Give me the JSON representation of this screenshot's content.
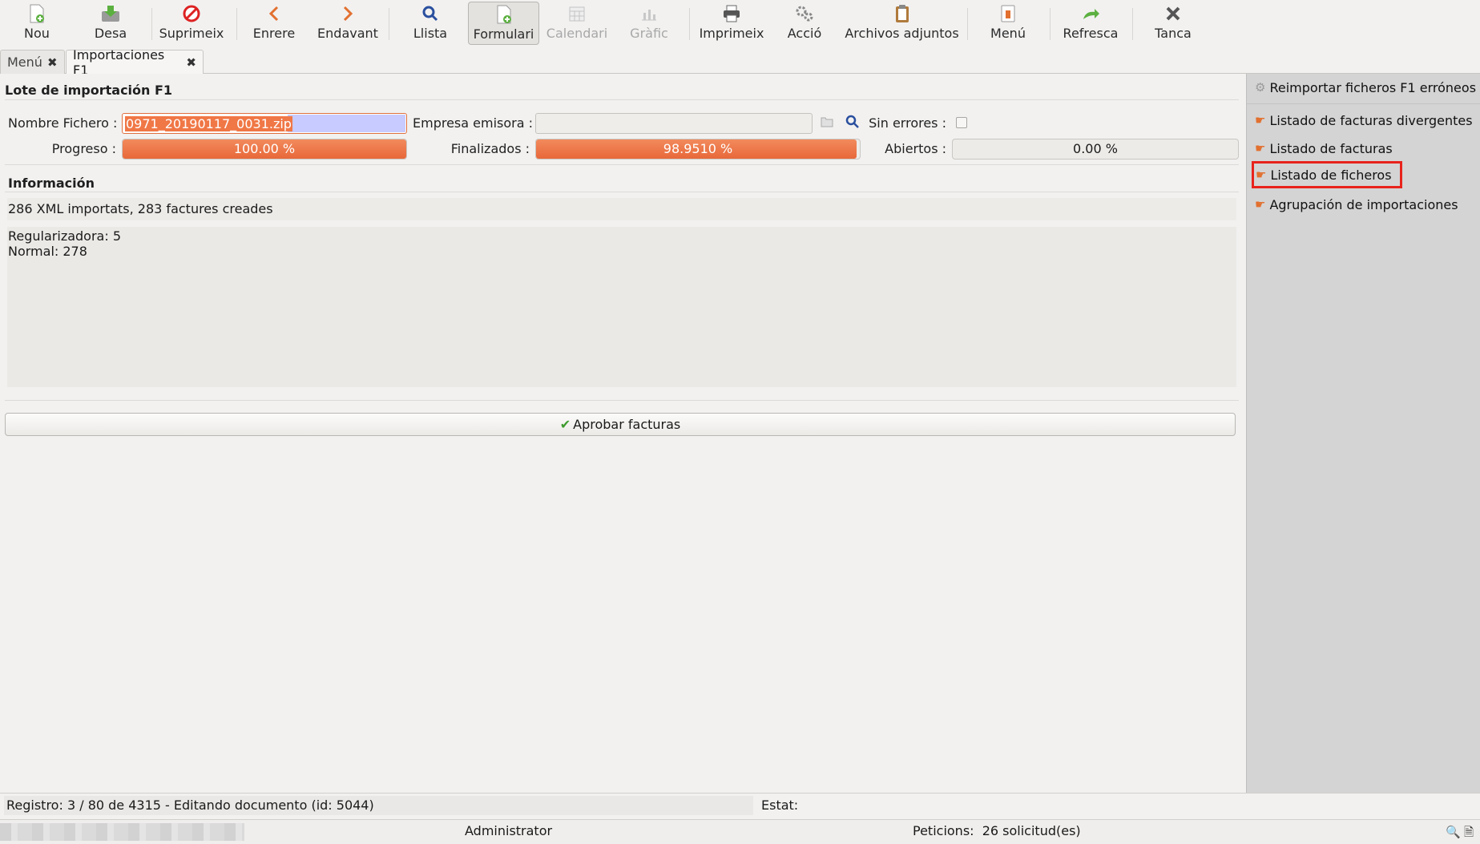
{
  "toolbar": {
    "new": "Nou",
    "save": "Desa",
    "delete": "Suprimeix",
    "back": "Enrere",
    "forward": "Endavant",
    "list": "Llista",
    "form": "Formulari",
    "calendar": "Calendari",
    "graph": "Gràfic",
    "print": "Imprimeix",
    "action": "Acció",
    "attachments": "Archivos adjuntos",
    "menu": "Menú",
    "refresh": "Refresca",
    "close": "Tanca"
  },
  "tabs": [
    {
      "label": "Menú",
      "close": "✖"
    },
    {
      "label": "Importaciones F1",
      "close": "✖"
    }
  ],
  "form": {
    "section_title": "Lote de importación F1",
    "filename_label": "Nombre Fichero :",
    "filename_value": "0971_20190117_0031.zip",
    "company_label": "Empresa emisora :",
    "company_value": "",
    "no_errors_label": "Sin errores :",
    "no_errors_checked": false,
    "progress_label": "Progreso :",
    "progress_text": "100.00 %",
    "progress_value": 100.0,
    "finished_label": "Finalizados :",
    "finished_text": "98.9510 %",
    "finished_value": 98.951,
    "open_label": "Abiertos :",
    "open_text": "0.00 %",
    "open_value": 0.0,
    "info_title": "Información",
    "info_summary": "286 XML importats, 283 factures creades",
    "info_details": "Regularizadora: 5\nNormal: 278",
    "approve_button": "Aprobar facturas"
  },
  "sidebar": {
    "items": [
      {
        "label": "Reimportar ficheros F1 erróneos",
        "icon": "gears-icon"
      },
      {
        "label": "Listado de facturas divergentes",
        "icon": "hand-icon"
      },
      {
        "label": "Listado de facturas",
        "icon": "hand-icon"
      },
      {
        "label": "Listado de ficheros",
        "icon": "hand-icon",
        "highlighted": true
      },
      {
        "label": "Agrupación de importaciones",
        "icon": "hand-icon"
      }
    ]
  },
  "status": {
    "record": "Registro: 3 / 80 de 4315 - Editando documento (id: 5044)",
    "state_label": "Estat:",
    "user": "Administrator",
    "requests": "Peticions:  26 solicitud(es)"
  },
  "colors": {
    "progress_fill": "#ec6f3e",
    "highlight_border": "#e8231c",
    "sidebar_bg": "#d4d4d4"
  }
}
